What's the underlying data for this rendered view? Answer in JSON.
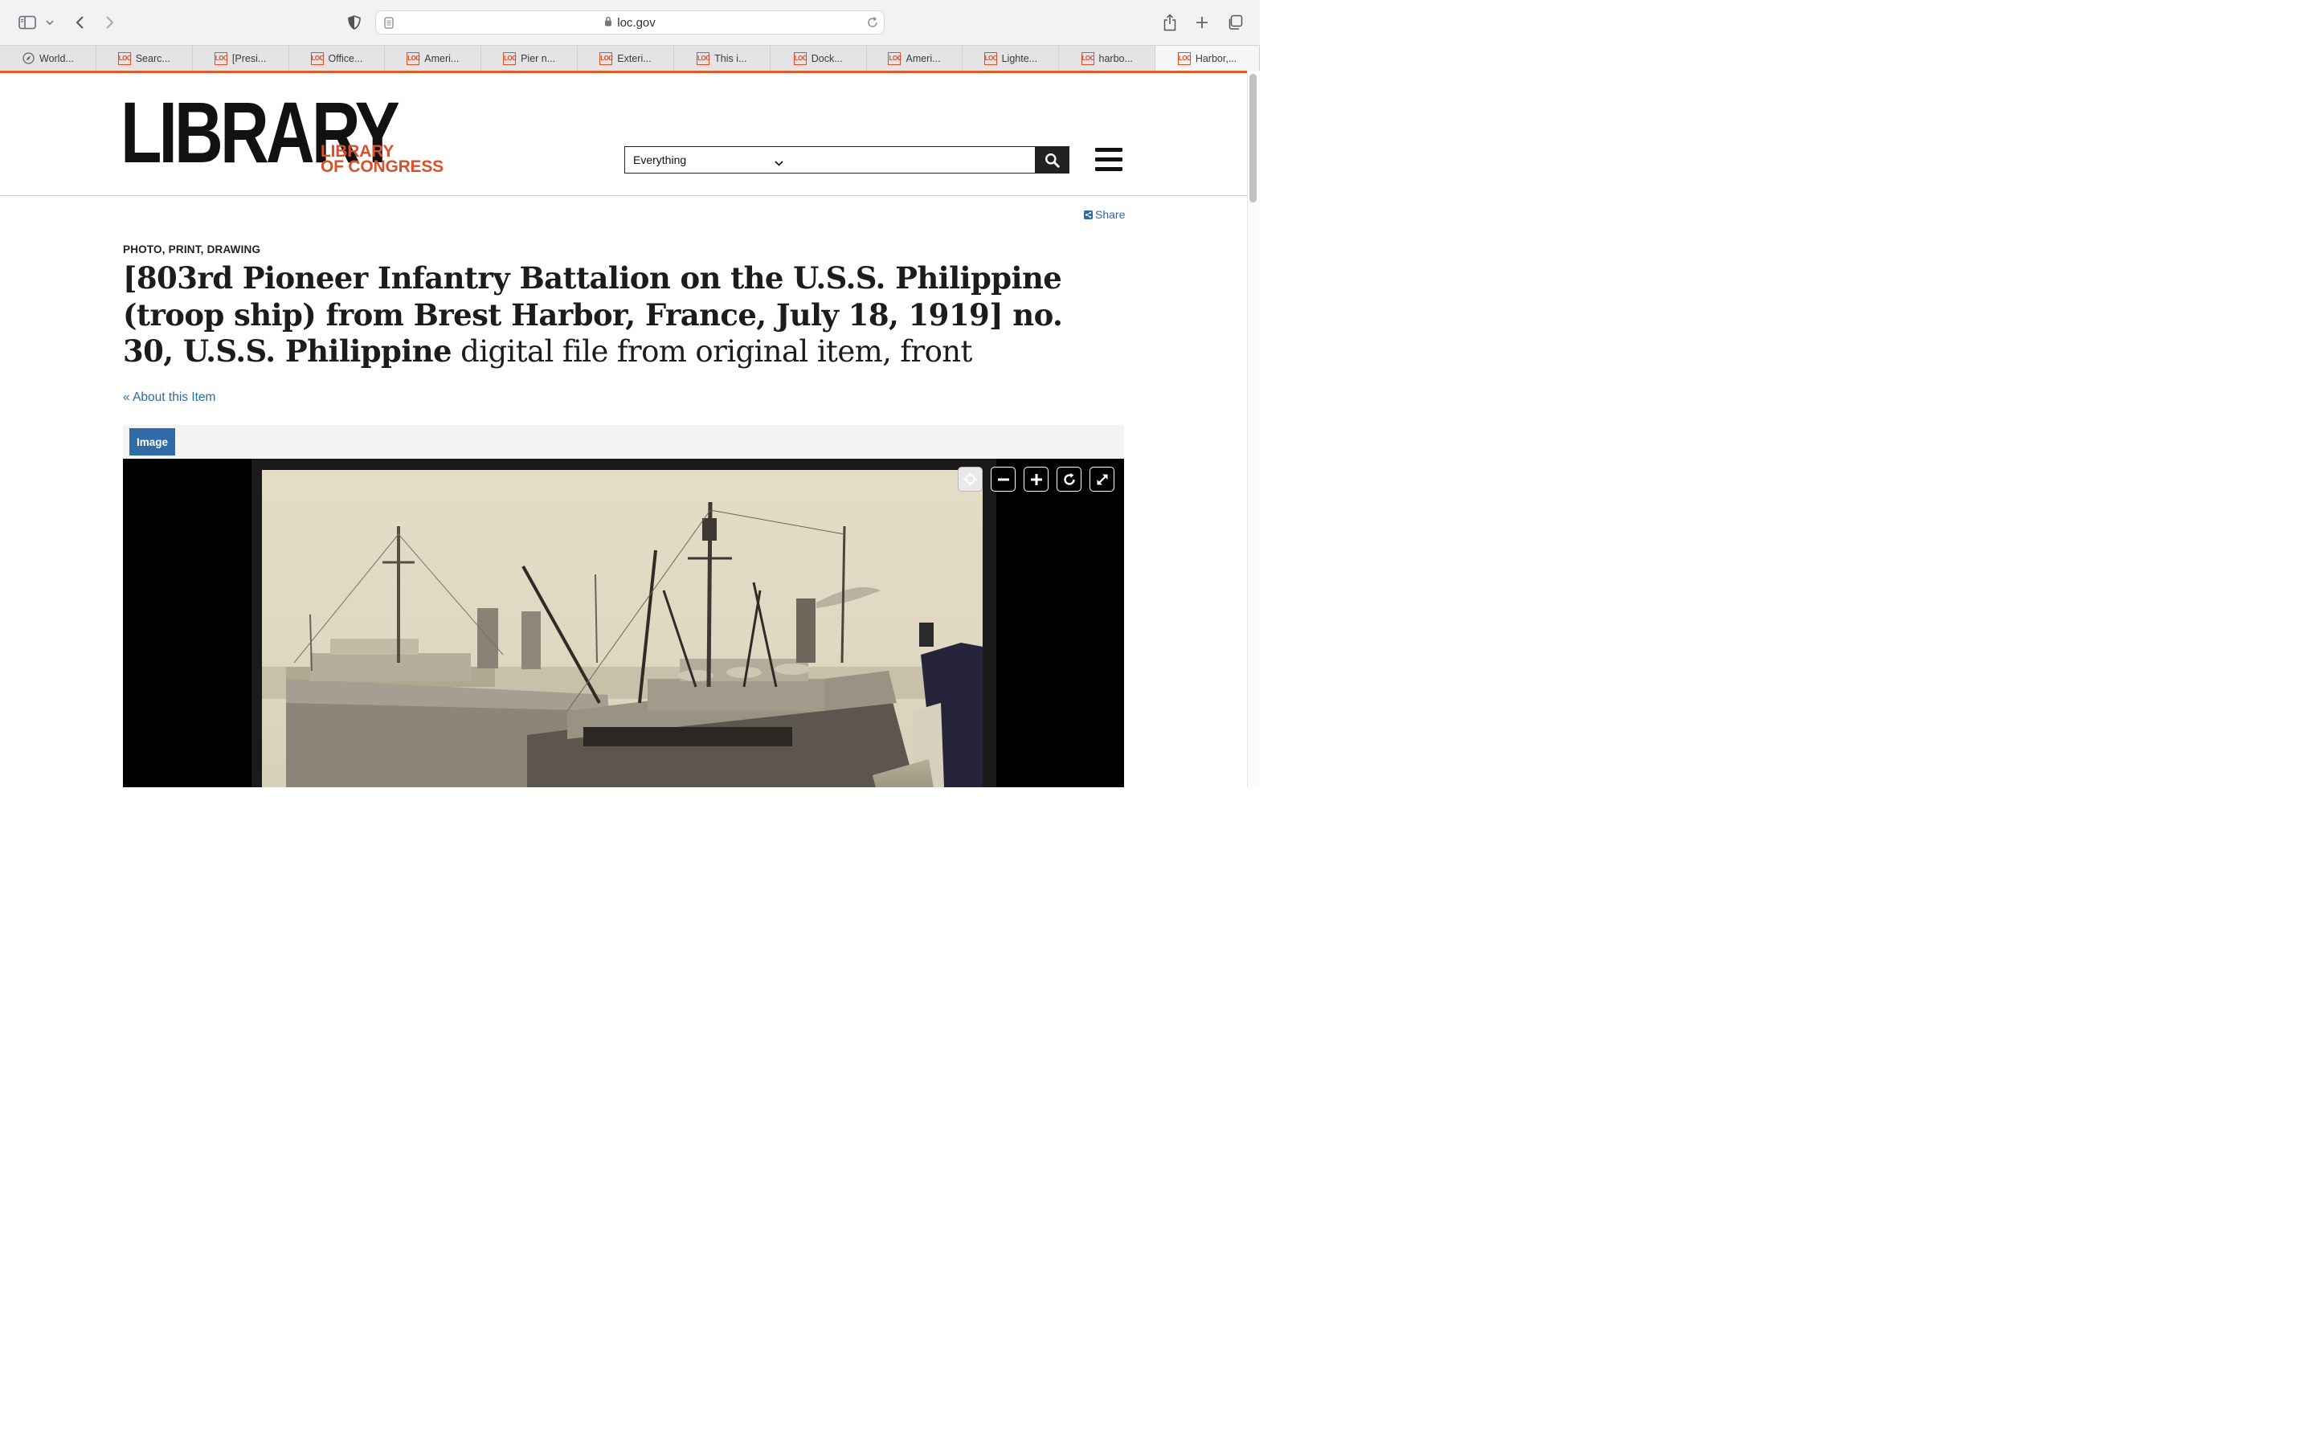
{
  "browser": {
    "url": "loc.gov",
    "tabs": [
      {
        "label": "World...",
        "icon": "compass-icon"
      },
      {
        "label": "Searc...",
        "icon": "loc-icon"
      },
      {
        "label": "[Presi...",
        "icon": "loc-icon"
      },
      {
        "label": "Office...",
        "icon": "loc-icon"
      },
      {
        "label": "Ameri...",
        "icon": "loc-icon"
      },
      {
        "label": "Pier n...",
        "icon": "loc-icon"
      },
      {
        "label": "Exteri...",
        "icon": "loc-icon"
      },
      {
        "label": "This i...",
        "icon": "loc-icon"
      },
      {
        "label": "Dock...",
        "icon": "loc-icon"
      },
      {
        "label": "Ameri...",
        "icon": "loc-icon"
      },
      {
        "label": "Lighte...",
        "icon": "loc-icon"
      },
      {
        "label": "harbo...",
        "icon": "loc-icon"
      },
      {
        "label": "Harbor,...",
        "icon": "loc-icon",
        "active": true
      }
    ],
    "favicon_text": "LOC",
    "accent_color": "#e05a2a"
  },
  "header": {
    "logo_main": "LIBRARY",
    "logo_sub_line1": "LIBRARY",
    "logo_sub_line2": "OF CONGRESS",
    "search_scope": "Everything",
    "search_query": "",
    "brand_color": "#d9512c"
  },
  "item": {
    "share_label": "Share",
    "format": "PHOTO, PRINT, DRAWING",
    "title_bold": "[803rd Pioneer Infantry Battalion on the U.S.S. Philippine (troop ship) from Brest Harbor, France, July 18, 1919] no. 30, U.S.S. Philippine",
    "title_rest": " digital file from original item, front",
    "about_link": "About this Item",
    "viewer_tab": "Image",
    "link_color": "#2b6aa3"
  }
}
